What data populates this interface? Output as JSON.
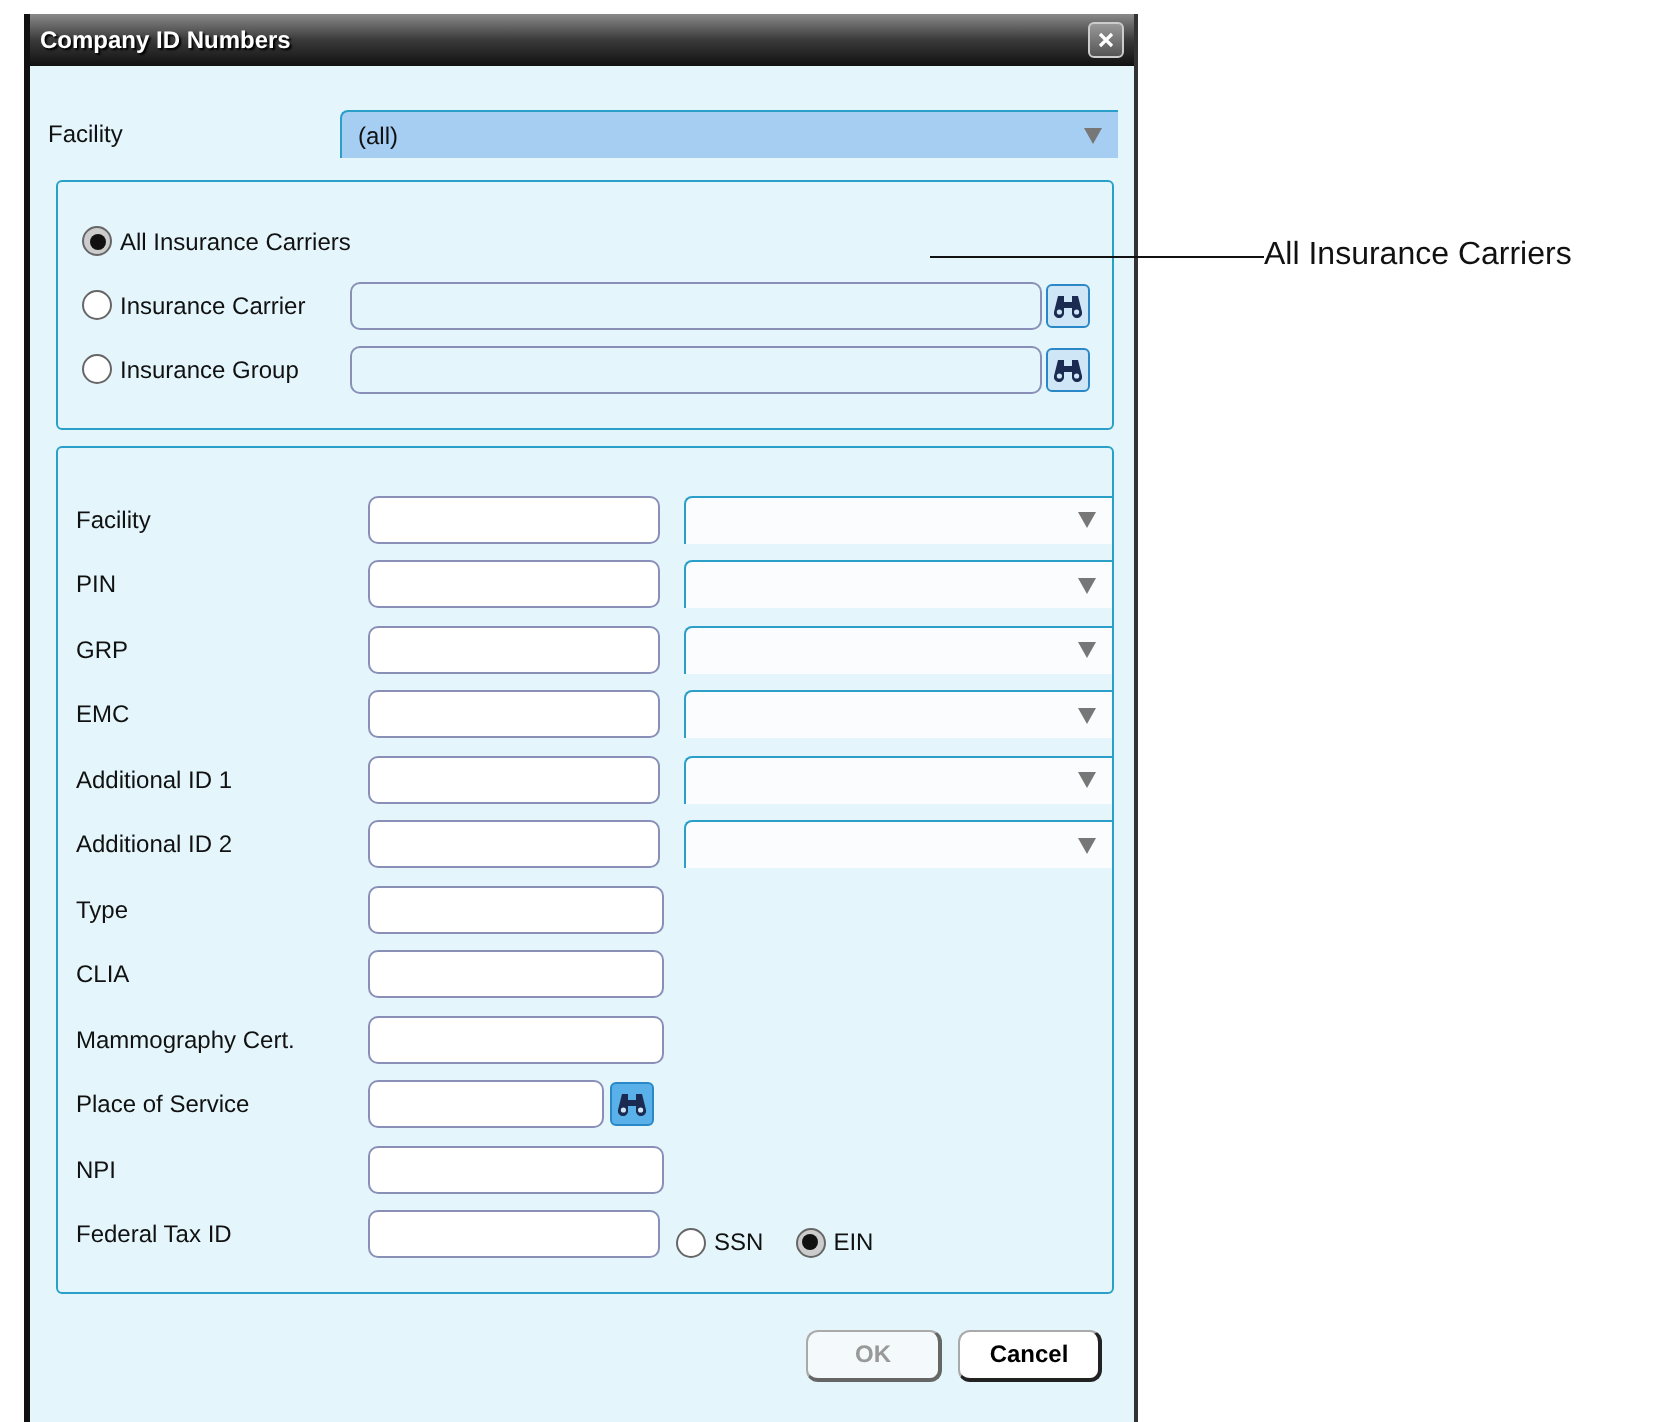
{
  "window": {
    "title": "Company ID Numbers"
  },
  "facility": {
    "label": "Facility",
    "value": "(all)"
  },
  "carrier_options": [
    {
      "label": "All Insurance Carriers",
      "selected": true,
      "kind": "plain"
    },
    {
      "label": "Insurance Carrier",
      "selected": false,
      "kind": "lookup"
    },
    {
      "label": "Insurance Group",
      "selected": false,
      "kind": "lookup"
    }
  ],
  "fields": [
    {
      "label": "Facility",
      "kind": "field-select"
    },
    {
      "label": "PIN",
      "kind": "field-select"
    },
    {
      "label": "GRP",
      "kind": "field-select"
    },
    {
      "label": "EMC",
      "kind": "field-select"
    },
    {
      "label": "Additional ID 1",
      "kind": "field-select"
    },
    {
      "label": "Additional ID 2",
      "kind": "field-select"
    },
    {
      "label": "Type",
      "kind": "field"
    },
    {
      "label": "CLIA",
      "kind": "field"
    },
    {
      "label": "Mammography Cert.",
      "kind": "field"
    },
    {
      "label": "Place of Service",
      "kind": "lookup"
    },
    {
      "label": "NPI",
      "kind": "field"
    },
    {
      "label": "Federal Tax ID",
      "kind": "tax",
      "options": [
        {
          "label": "SSN",
          "selected": false
        },
        {
          "label": "EIN",
          "selected": true
        }
      ]
    }
  ],
  "buttons": [
    {
      "label": "OK",
      "disabled": true
    },
    {
      "label": "Cancel",
      "disabled": false
    }
  ],
  "annotation": {
    "text": "All Insurance Carriers"
  }
}
